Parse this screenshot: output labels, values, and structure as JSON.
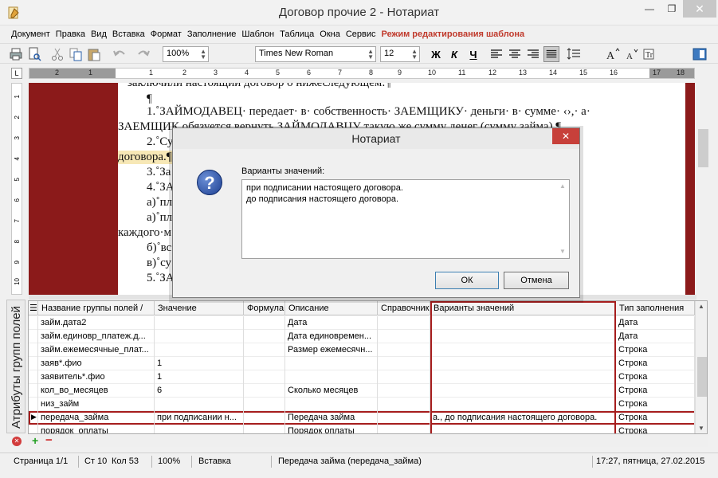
{
  "window": {
    "title": "Договор прочие 2 - Нотариат",
    "min_glyph": "—",
    "max_glyph": "❐",
    "close_glyph": "✕"
  },
  "menu": {
    "items": [
      "Документ",
      "Правка",
      "Вид",
      "Вставка",
      "Формат",
      "Заполнение",
      "Шаблон",
      "Таблица",
      "Окна",
      "Сервис"
    ],
    "mode_label": "Режим редактирования шаблона"
  },
  "toolbar": {
    "zoom": "100%",
    "font": "Times New Roman",
    "size": "12",
    "bold": "Ж",
    "italic": "К",
    "underline": "Ч",
    "icons": [
      "print-icon",
      "print-preview-icon",
      "cut-icon",
      "copy-icon",
      "paste-icon",
      "undo-icon",
      "redo-icon",
      "align-left-icon",
      "align-center-icon",
      "align-right-icon",
      "align-justify-icon",
      "line-spacing-icon",
      "grow-font-icon",
      "shrink-font-icon",
      "text-style-icon",
      "sidebar-toggle-icon"
    ]
  },
  "ruler": {
    "corner": "L",
    "numbers": [
      "2",
      "1",
      "1",
      "2",
      "3",
      "4",
      "5",
      "6",
      "7",
      "8",
      "9",
      "10",
      "11",
      "12",
      "13",
      "14",
      "15",
      "16",
      "17",
      "18"
    ],
    "vnumbers": [
      "1",
      "2",
      "3",
      "4",
      "5",
      "6",
      "7",
      "8",
      "9",
      "10"
    ]
  },
  "document": {
    "lines": [
      "заключили настоящий договор о нижеследующем:¶",
      "¶",
      "1.˚ЗАЙМОДАВЕЦ· передает· в· собственность· ЗАЕМЩИКУ· деньги· в· сумме· ‹›,· а·",
      "ЗАЕМЩИК обязуется вернуть ЗАЙМОДАВЦУ такую же сумму денег (сумму займа).¶",
      "2.˚Су                                                                              настоящего·",
      "договора.¶",
      "3.˚За                                                                              ¶",
      "4.˚ЗА",
      "а)˚пл                                                                              $¶",
      "а)˚пл                                                                              о· ‹›· числа·",
      "каждого·м",
      "б)˚вс",
      "в)˚су",
      "5.˚ЗА                                                                              ВЦА.·¶"
    ]
  },
  "attributes_panel": {
    "tab_label": "Атрибуты групп полей",
    "columns": [
      "Название группы полей",
      "Значение",
      "Формула",
      "Описание",
      "Справочник",
      "Варианты значений",
      "Тип заполнения"
    ],
    "rows": [
      {
        "name": "займ.дата2",
        "value": "",
        "formula": "",
        "desc": "Дата",
        "ref": "",
        "variants": "",
        "type": "Дата"
      },
      {
        "name": "займ.единовр_платеж.д...",
        "value": "",
        "formula": "",
        "desc": "Дата единовремен...",
        "ref": "",
        "variants": "",
        "type": "Дата"
      },
      {
        "name": "займ.ежемесячные_плат...",
        "value": "",
        "formula": "",
        "desc": "Размер ежемесячн...",
        "ref": "",
        "variants": "",
        "type": "Строка"
      },
      {
        "name": "заяв*.фио",
        "value": "1",
        "formula": "",
        "desc": "",
        "ref": "",
        "variants": "",
        "type": "Строка"
      },
      {
        "name": "заявитель*.фио",
        "value": "1",
        "formula": "",
        "desc": "",
        "ref": "",
        "variants": "",
        "type": "Строка"
      },
      {
        "name": "кол_во_месяцев",
        "value": "6",
        "formula": "",
        "desc": "Сколько месяцев",
        "ref": "",
        "variants": "",
        "type": "Строка"
      },
      {
        "name": "низ_займ",
        "value": "",
        "formula": "",
        "desc": "",
        "ref": "",
        "variants": "",
        "type": "Строка"
      },
      {
        "name": "передача_займа",
        "value": "при подписании н...",
        "formula": "",
        "desc": "Передача займа",
        "ref": "",
        "variants": "а., до подписания настоящего договора.",
        "type": "Строка",
        "selected": true
      },
      {
        "name": "порядок_оплаты",
        "value": "",
        "formula": "",
        "desc": "Порядок оплаты",
        "ref": "",
        "variants": "",
        "type": "Строка"
      }
    ],
    "add": "+",
    "remove": "−"
  },
  "status": {
    "page": "Страница 1/1",
    "line": "Ст 10",
    "col": "Кол 53",
    "zoom": "100%",
    "mode": "Вставка",
    "field": "Передача займа (передача_займа)",
    "datetime": "17:27, пятница, 27.02.2015"
  },
  "dialog": {
    "title": "Нотариат",
    "label": "Варианты значений:",
    "lines": [
      "при подписании настоящего договора.",
      "до подписания настоящего договора."
    ],
    "ok": "ОК",
    "cancel": "Отмена"
  }
}
